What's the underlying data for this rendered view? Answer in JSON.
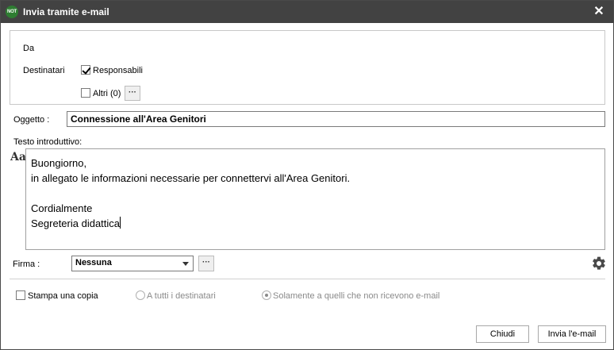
{
  "window": {
    "app_badge": "NOT",
    "title": "Invia tramite e-mail",
    "close_glyph": "✕",
    "close_icon": "close-icon"
  },
  "sender": {
    "label": "Da"
  },
  "recipients": {
    "label": "Destinatari",
    "responsabili_label": "Responsabili",
    "responsabili_checked": true,
    "altri_label": "Altri (0)",
    "altri_checked": false,
    "more_glyph": "···"
  },
  "subject": {
    "label": "Oggetto :",
    "value": "Connessione all'Area Genitori"
  },
  "intro": {
    "label": "Testo introduttivo:",
    "format_icon_text": "Aa",
    "lines": [
      "Buongiorno,",
      "in allegato le informazioni necessarie per connettervi all'Area Genitori.",
      "",
      "Cordialmente",
      "Segreteria didattica"
    ]
  },
  "signature": {
    "label": "Firma :",
    "selected": "Nessuna",
    "more_glyph": "···",
    "settings_icon": "gear-icon"
  },
  "print": {
    "checkbox_label": "Stampa una copia",
    "checked": false,
    "option_all": "A tutti i destinatari",
    "option_non_email": "Solamente a quelli che non ricevono e-mail",
    "selected_option": "non_email"
  },
  "actions": {
    "close_label": "Chiudi",
    "send_label": "Invia l'e-mail"
  },
  "colors": {
    "titlebar": "#424242",
    "badge": "#2e7d32",
    "border": "#c8c8c8"
  }
}
